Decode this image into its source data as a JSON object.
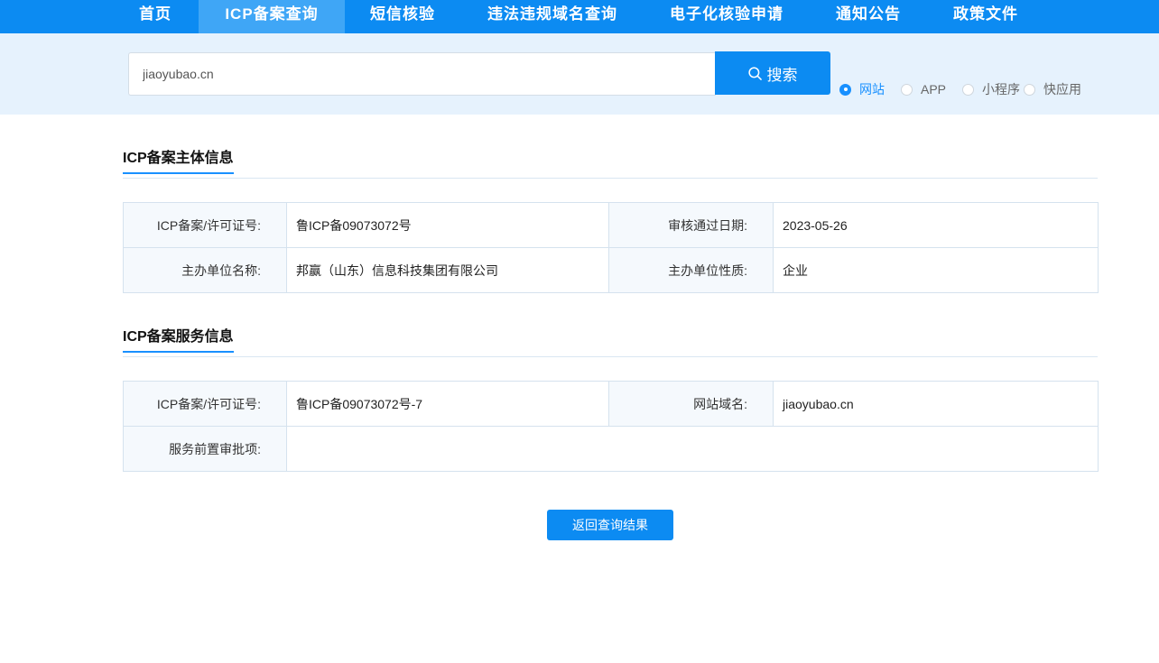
{
  "nav": {
    "items": [
      {
        "label": "首页"
      },
      {
        "label": "ICP备案查询"
      },
      {
        "label": "短信核验"
      },
      {
        "label": "违法违规域名查询"
      },
      {
        "label": "电子化核验申请"
      },
      {
        "label": "通知公告"
      },
      {
        "label": "政策文件"
      }
    ],
    "active": "ICP备案查询"
  },
  "search": {
    "value": "jiaoyubao.cn",
    "button_label": "搜索",
    "button_icon": "search-icon",
    "types": [
      {
        "label": "网站",
        "checked": true
      },
      {
        "label": "APP",
        "checked": false
      },
      {
        "label": "小程序",
        "checked": false
      },
      {
        "label": "快应用",
        "checked": false
      }
    ]
  },
  "subject_info": {
    "title": "ICP备案主体信息",
    "rows": [
      {
        "license_label": "ICP备案/许可证号:",
        "license_value": "鲁ICP备09073072号",
        "date_label": "审核通过日期:",
        "date_value": "2023-05-26"
      },
      {
        "org_label": "主办单位名称:",
        "org_value": "邦赢（山东）信息科技集团有限公司",
        "nature_label": "主办单位性质:",
        "nature_value": "企业"
      }
    ]
  },
  "service_info": {
    "title": "ICP备案服务信息",
    "license_label": "ICP备案/许可证号:",
    "license_value": "鲁ICP备09073072号-7",
    "domain_label": "网站域名:",
    "domain_value": "jiaoyubao.cn",
    "approval_label": "服务前置审批项:",
    "approval_value": ""
  },
  "back_button_label": "返回查询结果",
  "colors": {
    "primary": "#0c8bf2",
    "nav_active": "#3fa6f6",
    "search_band": "#e6f2fd",
    "label_cell": "#f5f9fd",
    "border": "#d5e2ee"
  }
}
